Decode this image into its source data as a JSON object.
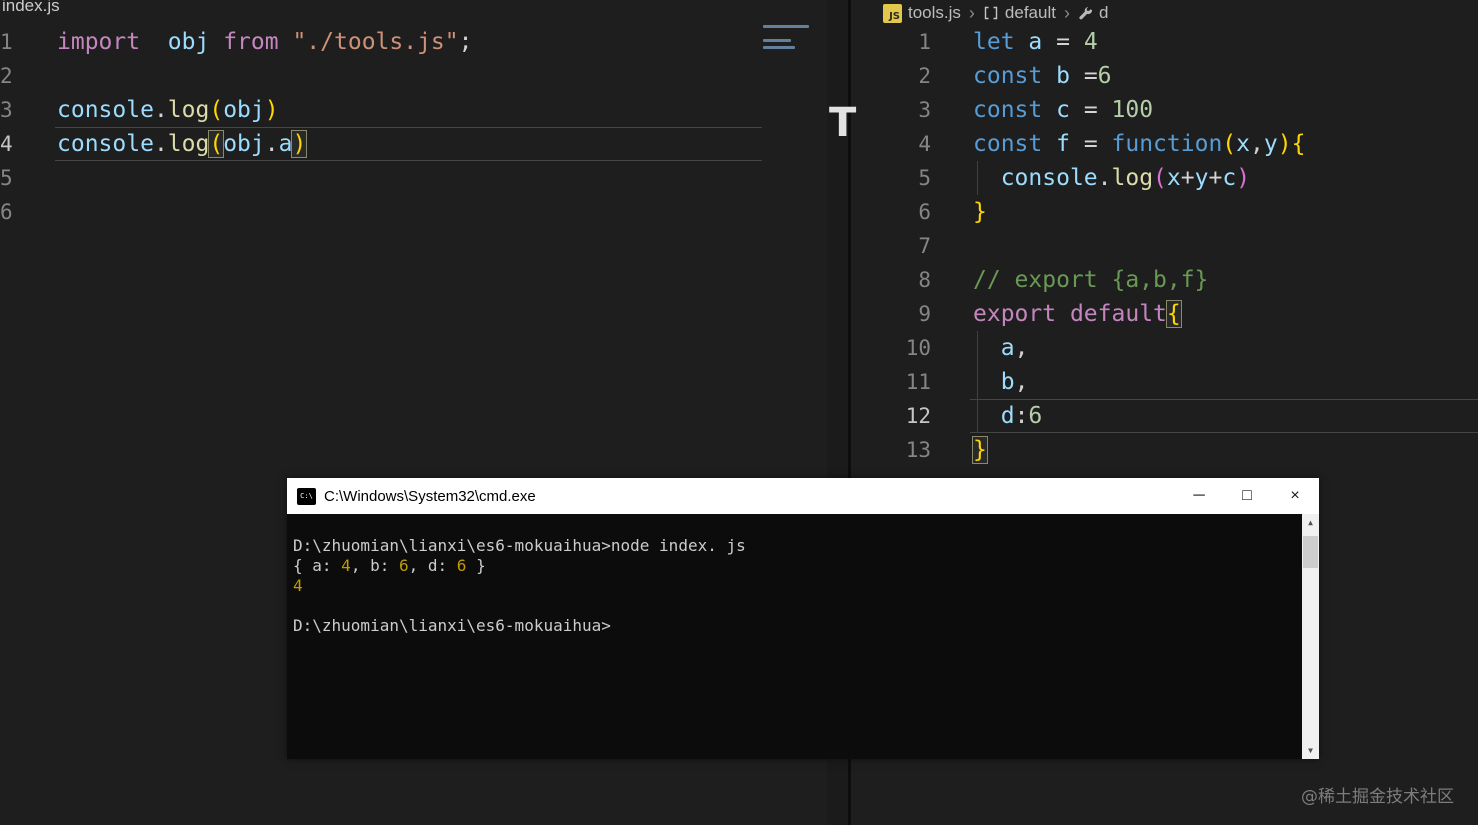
{
  "colors": {
    "editor_background": "#1e1e1e",
    "terminal_background": "#0c0c0c",
    "titlebar_background": "#ffffff",
    "keyword_magenta": "#c586c0",
    "keyword_blue": "#569cd6",
    "variable_blue": "#9cdcfe",
    "string_orange": "#ce9178",
    "number_green": "#b5cea8",
    "comment_green": "#6a9955",
    "bracket_gold": "#ffd700",
    "bracket_pink": "#da70d6",
    "terminal_number_yellow": "#c19c00",
    "js_badge_yellow": "#e3c74b"
  },
  "artifact_text": "T",
  "watermark": "@稀土掘金技术社区",
  "left_editor": {
    "tab_label": "index.js",
    "active_line": 4,
    "gutter": [
      "1",
      "2",
      "3",
      "4",
      "5",
      "6"
    ],
    "lines": [
      [
        [
          "import",
          "kw"
        ],
        [
          "  ",
          "punc"
        ],
        [
          "obj",
          "var"
        ],
        [
          " ",
          "punc"
        ],
        [
          "from",
          "kw"
        ],
        [
          " ",
          "punc"
        ],
        [
          "\"./tools.js\"",
          "str"
        ],
        [
          ";",
          "punc"
        ]
      ],
      [],
      [
        [
          "console",
          "var"
        ],
        [
          ".",
          "punc"
        ],
        [
          "log",
          "fn"
        ],
        [
          "(",
          "brk1"
        ],
        [
          "obj",
          "var"
        ],
        [
          ")",
          "brk1"
        ]
      ],
      [
        [
          "console",
          "var"
        ],
        [
          ".",
          "punc"
        ],
        [
          "log",
          "fn"
        ],
        [
          "(",
          "brk1",
          "box"
        ],
        [
          "obj",
          "var"
        ],
        [
          ".",
          "punc"
        ],
        [
          "a",
          "var"
        ],
        [
          ")",
          "brk1",
          "box"
        ]
      ],
      [],
      []
    ]
  },
  "right_editor": {
    "breadcrumb": {
      "file_icon_text": "JS",
      "file": "tools.js",
      "separator": "›",
      "symbol": "default",
      "member": "d"
    },
    "active_line": 12,
    "gutter": [
      "1",
      "2",
      "3",
      "4",
      "5",
      "6",
      "7",
      "8",
      "9",
      "10",
      "11",
      "12",
      "13"
    ],
    "lines": [
      [
        [
          "let",
          "kw2"
        ],
        [
          " ",
          "punc"
        ],
        [
          "a",
          "var"
        ],
        [
          " = ",
          "punc"
        ],
        [
          "4",
          "num"
        ]
      ],
      [
        [
          "const",
          "kw2"
        ],
        [
          " ",
          "punc"
        ],
        [
          "b",
          "var"
        ],
        [
          " =",
          "punc"
        ],
        [
          "6",
          "num"
        ]
      ],
      [
        [
          "const",
          "kw2"
        ],
        [
          " ",
          "punc"
        ],
        [
          "c",
          "var"
        ],
        [
          " = ",
          "punc"
        ],
        [
          "100",
          "num"
        ]
      ],
      [
        [
          "const",
          "kw2"
        ],
        [
          " ",
          "punc"
        ],
        [
          "f",
          "var"
        ],
        [
          " = ",
          "punc"
        ],
        [
          "function",
          "kw2"
        ],
        [
          "(",
          "brk1"
        ],
        [
          "x",
          "var"
        ],
        [
          ",",
          "punc"
        ],
        [
          "y",
          "var"
        ],
        [
          ")",
          "brk1"
        ],
        [
          "{",
          "brk1"
        ]
      ],
      [
        [
          "  ",
          "punc"
        ],
        [
          "console",
          "var"
        ],
        [
          ".",
          "punc"
        ],
        [
          "log",
          "fn"
        ],
        [
          "(",
          "brk2"
        ],
        [
          "x",
          "var"
        ],
        [
          "+",
          "punc"
        ],
        [
          "y",
          "var"
        ],
        [
          "+",
          "punc"
        ],
        [
          "c",
          "var"
        ],
        [
          ")",
          "brk2"
        ]
      ],
      [
        [
          "}",
          "brk1"
        ]
      ],
      [],
      [
        [
          "// export {a,b,f}",
          "cmt"
        ]
      ],
      [
        [
          "export",
          "kw"
        ],
        [
          " ",
          "punc"
        ],
        [
          "default",
          "kw"
        ],
        [
          "{",
          "brk1",
          "box"
        ]
      ],
      [
        [
          "  ",
          "punc"
        ],
        [
          "a",
          "var"
        ],
        [
          ",",
          "punc"
        ]
      ],
      [
        [
          "  ",
          "punc"
        ],
        [
          "b",
          "var"
        ],
        [
          ",",
          "punc"
        ]
      ],
      [
        [
          "  ",
          "punc"
        ],
        [
          "d",
          "var"
        ],
        [
          ":",
          "punc"
        ],
        [
          "6",
          "num"
        ]
      ],
      [
        [
          "}",
          "brk1",
          "box"
        ]
      ]
    ]
  },
  "cmd": {
    "icon_text": "C:\\",
    "title": "C:\\Windows\\System32\\cmd.exe",
    "controls": {
      "minimize": "─",
      "maximize": "□",
      "close": "×"
    },
    "scroll_up": "▲",
    "scroll_down": "▼",
    "lines": [
      [
        [
          "D:\\zhuomian\\lianxi\\es6-mokuaihua>node index. js",
          "w"
        ]
      ],
      [
        [
          "{ a: ",
          "w"
        ],
        [
          "4",
          "y"
        ],
        [
          ", b: ",
          "w"
        ],
        [
          "6",
          "y"
        ],
        [
          ", d: ",
          "w"
        ],
        [
          "6",
          "y"
        ],
        [
          " }",
          "w"
        ]
      ],
      [
        [
          "4",
          "y"
        ]
      ],
      [],
      [
        [
          "D:\\zhuomian\\lianxi\\es6-mokuaihua>",
          "w"
        ]
      ]
    ]
  }
}
